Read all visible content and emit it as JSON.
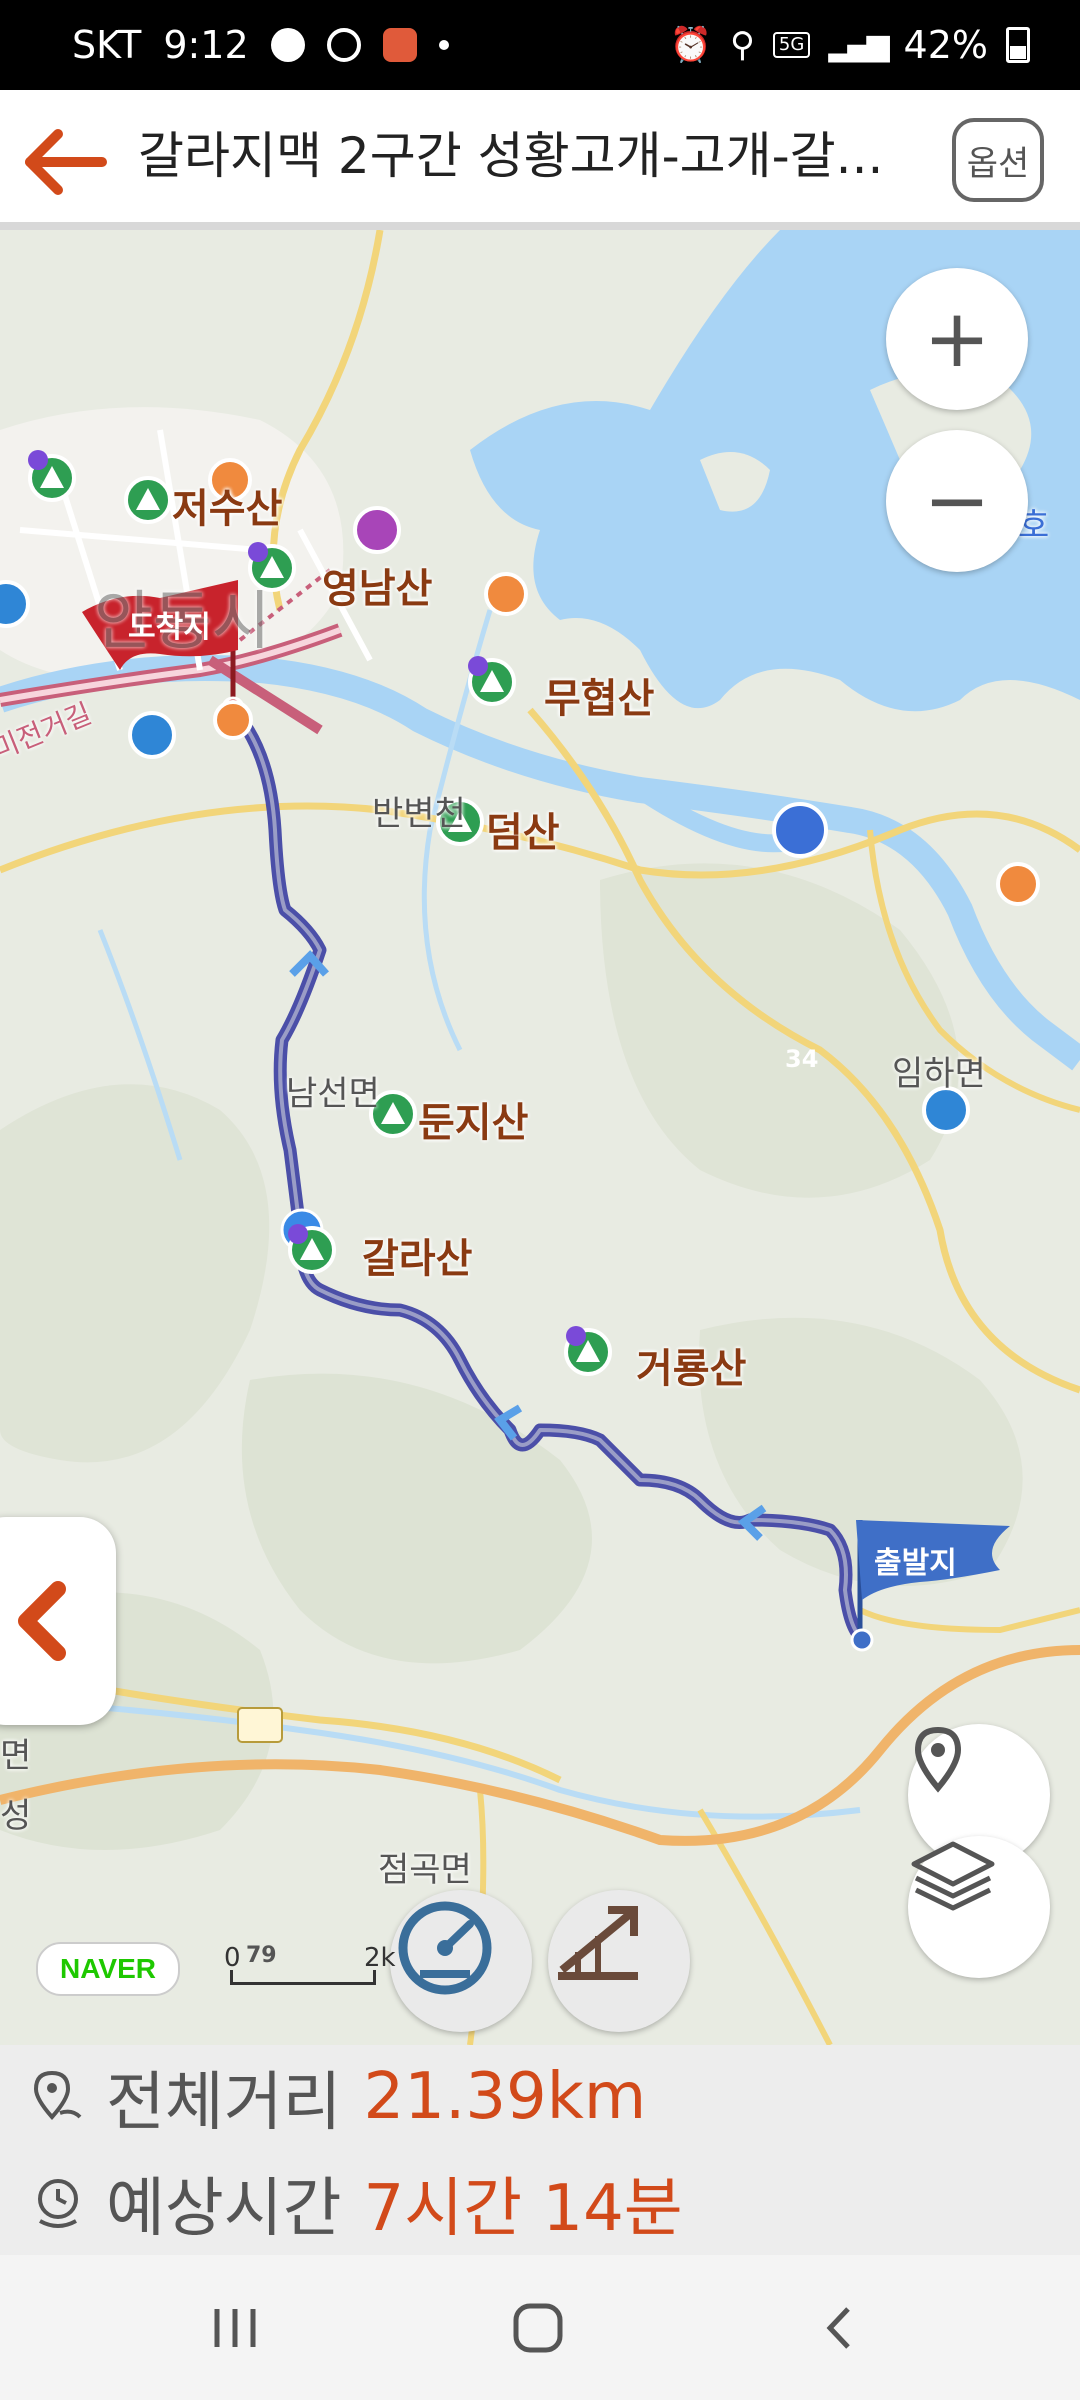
{
  "status_bar": {
    "carrier": "SKT",
    "time": "9:12",
    "battery": "42%",
    "network": "5G"
  },
  "header": {
    "title": "갈라지맥 2구간 성황고개-고개-갈...",
    "options_label": "옵션"
  },
  "map": {
    "zoom_in_label": "+",
    "zoom_out_label": "−",
    "arrival_flag_label": "도착지",
    "departure_flag_label": "출발지",
    "city_label": "안동시",
    "road_label": "미전거길",
    "partial_right_label": "호",
    "partial_left_label": "면",
    "partial_left_label2": "성",
    "route_number_34": "34",
    "route_number_79": "79",
    "poi": {
      "jeosusan": "저수산",
      "yeongnamsan": "영남산",
      "muhyeopsan": "무협산",
      "deomsan": "덤산",
      "dunjisan": "둔지산",
      "gallasan": "갈라산",
      "georyongsan": "거룡산"
    },
    "towns": {
      "banbyeon": "반변천",
      "namseon": "남선면",
      "imha": "임하면",
      "jeomgok": "점곡면"
    },
    "naver_logo": "NAVER",
    "scale_start": "0",
    "scale_end": "2k"
  },
  "summary": {
    "distance_label": "전체거리",
    "distance_value": "21.39km",
    "time_label": "예상시간",
    "time_value": "7시간 14분"
  },
  "colors": {
    "accent": "#d24a1a",
    "route": "#4b4fa8",
    "water": "#a9d4f5",
    "arrival_flag": "#c8232c",
    "departure_flag": "#3f6fc7"
  }
}
